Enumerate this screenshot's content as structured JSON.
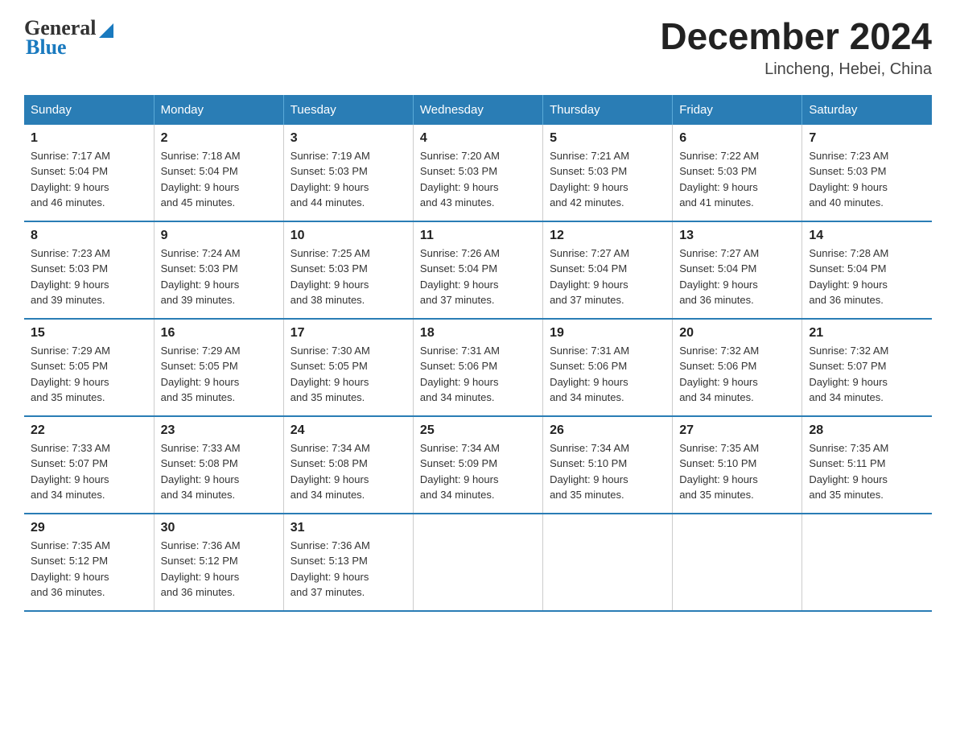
{
  "header": {
    "logo_general": "General",
    "logo_blue": "Blue",
    "month_title": "December 2024",
    "location": "Lincheng, Hebei, China"
  },
  "weekdays": [
    "Sunday",
    "Monday",
    "Tuesday",
    "Wednesday",
    "Thursday",
    "Friday",
    "Saturday"
  ],
  "weeks": [
    [
      {
        "day": "1",
        "sunrise": "7:17 AM",
        "sunset": "5:04 PM",
        "daylight": "9 hours and 46 minutes."
      },
      {
        "day": "2",
        "sunrise": "7:18 AM",
        "sunset": "5:04 PM",
        "daylight": "9 hours and 45 minutes."
      },
      {
        "day": "3",
        "sunrise": "7:19 AM",
        "sunset": "5:03 PM",
        "daylight": "9 hours and 44 minutes."
      },
      {
        "day": "4",
        "sunrise": "7:20 AM",
        "sunset": "5:03 PM",
        "daylight": "9 hours and 43 minutes."
      },
      {
        "day": "5",
        "sunrise": "7:21 AM",
        "sunset": "5:03 PM",
        "daylight": "9 hours and 42 minutes."
      },
      {
        "day": "6",
        "sunrise": "7:22 AM",
        "sunset": "5:03 PM",
        "daylight": "9 hours and 41 minutes."
      },
      {
        "day": "7",
        "sunrise": "7:23 AM",
        "sunset": "5:03 PM",
        "daylight": "9 hours and 40 minutes."
      }
    ],
    [
      {
        "day": "8",
        "sunrise": "7:23 AM",
        "sunset": "5:03 PM",
        "daylight": "9 hours and 39 minutes."
      },
      {
        "day": "9",
        "sunrise": "7:24 AM",
        "sunset": "5:03 PM",
        "daylight": "9 hours and 39 minutes."
      },
      {
        "day": "10",
        "sunrise": "7:25 AM",
        "sunset": "5:03 PM",
        "daylight": "9 hours and 38 minutes."
      },
      {
        "day": "11",
        "sunrise": "7:26 AM",
        "sunset": "5:04 PM",
        "daylight": "9 hours and 37 minutes."
      },
      {
        "day": "12",
        "sunrise": "7:27 AM",
        "sunset": "5:04 PM",
        "daylight": "9 hours and 37 minutes."
      },
      {
        "day": "13",
        "sunrise": "7:27 AM",
        "sunset": "5:04 PM",
        "daylight": "9 hours and 36 minutes."
      },
      {
        "day": "14",
        "sunrise": "7:28 AM",
        "sunset": "5:04 PM",
        "daylight": "9 hours and 36 minutes."
      }
    ],
    [
      {
        "day": "15",
        "sunrise": "7:29 AM",
        "sunset": "5:05 PM",
        "daylight": "9 hours and 35 minutes."
      },
      {
        "day": "16",
        "sunrise": "7:29 AM",
        "sunset": "5:05 PM",
        "daylight": "9 hours and 35 minutes."
      },
      {
        "day": "17",
        "sunrise": "7:30 AM",
        "sunset": "5:05 PM",
        "daylight": "9 hours and 35 minutes."
      },
      {
        "day": "18",
        "sunrise": "7:31 AM",
        "sunset": "5:06 PM",
        "daylight": "9 hours and 34 minutes."
      },
      {
        "day": "19",
        "sunrise": "7:31 AM",
        "sunset": "5:06 PM",
        "daylight": "9 hours and 34 minutes."
      },
      {
        "day": "20",
        "sunrise": "7:32 AM",
        "sunset": "5:06 PM",
        "daylight": "9 hours and 34 minutes."
      },
      {
        "day": "21",
        "sunrise": "7:32 AM",
        "sunset": "5:07 PM",
        "daylight": "9 hours and 34 minutes."
      }
    ],
    [
      {
        "day": "22",
        "sunrise": "7:33 AM",
        "sunset": "5:07 PM",
        "daylight": "9 hours and 34 minutes."
      },
      {
        "day": "23",
        "sunrise": "7:33 AM",
        "sunset": "5:08 PM",
        "daylight": "9 hours and 34 minutes."
      },
      {
        "day": "24",
        "sunrise": "7:34 AM",
        "sunset": "5:08 PM",
        "daylight": "9 hours and 34 minutes."
      },
      {
        "day": "25",
        "sunrise": "7:34 AM",
        "sunset": "5:09 PM",
        "daylight": "9 hours and 34 minutes."
      },
      {
        "day": "26",
        "sunrise": "7:34 AM",
        "sunset": "5:10 PM",
        "daylight": "9 hours and 35 minutes."
      },
      {
        "day": "27",
        "sunrise": "7:35 AM",
        "sunset": "5:10 PM",
        "daylight": "9 hours and 35 minutes."
      },
      {
        "day": "28",
        "sunrise": "7:35 AM",
        "sunset": "5:11 PM",
        "daylight": "9 hours and 35 minutes."
      }
    ],
    [
      {
        "day": "29",
        "sunrise": "7:35 AM",
        "sunset": "5:12 PM",
        "daylight": "9 hours and 36 minutes."
      },
      {
        "day": "30",
        "sunrise": "7:36 AM",
        "sunset": "5:12 PM",
        "daylight": "9 hours and 36 minutes."
      },
      {
        "day": "31",
        "sunrise": "7:36 AM",
        "sunset": "5:13 PM",
        "daylight": "9 hours and 37 minutes."
      },
      null,
      null,
      null,
      null
    ]
  ],
  "labels": {
    "sunrise": "Sunrise:",
    "sunset": "Sunset:",
    "daylight": "Daylight:"
  }
}
